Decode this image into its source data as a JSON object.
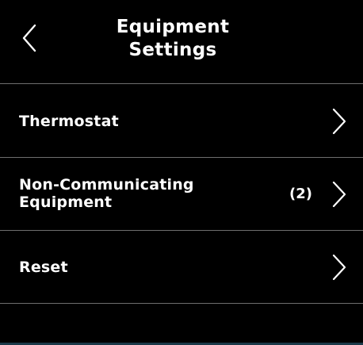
{
  "header": {
    "title": "Equipment\nSettings",
    "back_icon": "chevron-left-icon"
  },
  "menu": {
    "items": [
      {
        "label": "Thermostat",
        "count": "",
        "icon": "chevron-right-icon"
      },
      {
        "label": "Non-Communicating\nEquipment",
        "count": "(2)",
        "icon": "chevron-right-icon"
      },
      {
        "label": "Reset",
        "count": "",
        "icon": "chevron-right-icon"
      }
    ]
  },
  "colors": {
    "background": "#000000",
    "text": "#ffffff",
    "divider": "#6e6e6e",
    "bottom_accent": "#1b3a49"
  }
}
